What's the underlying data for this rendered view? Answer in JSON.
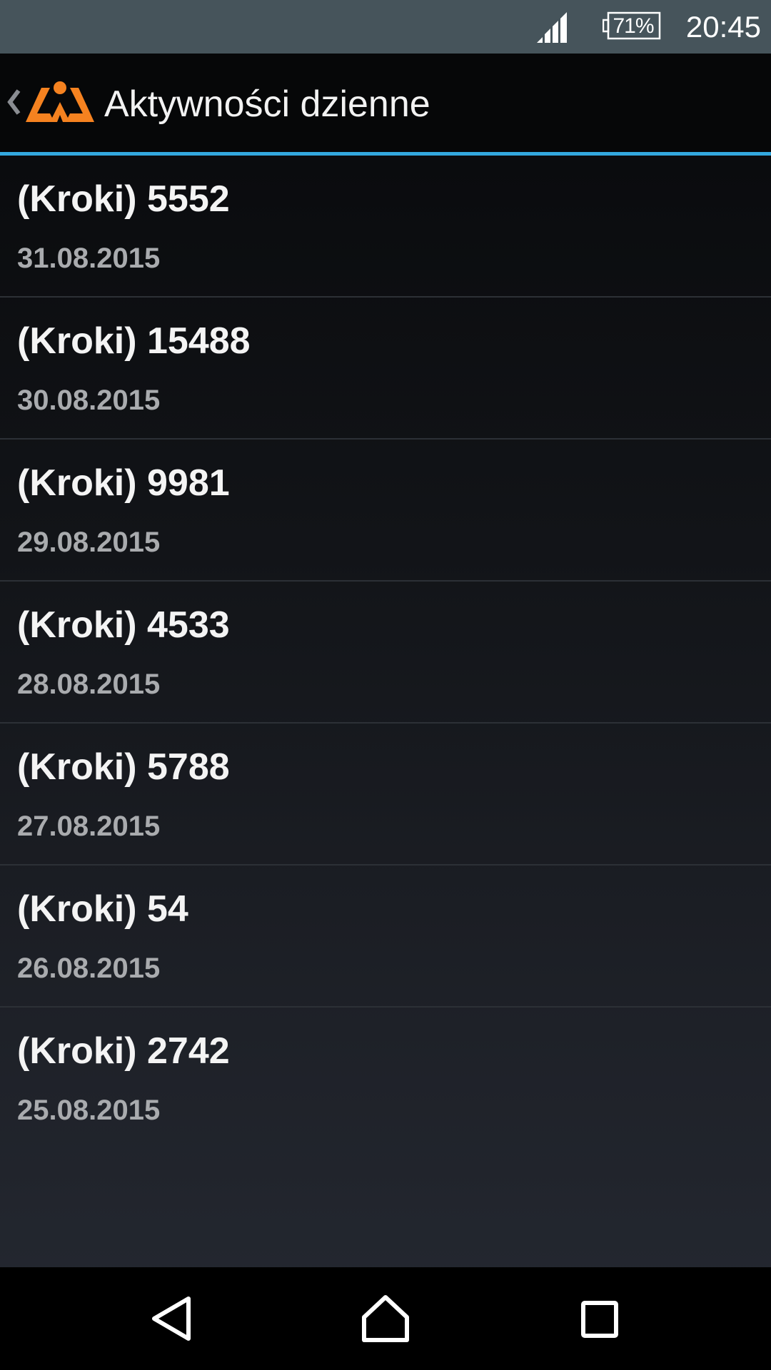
{
  "status_bar": {
    "battery_percent": "71%",
    "time": "20:45",
    "icons": [
      "signal-icon",
      "battery-icon"
    ],
    "color": "#46545b"
  },
  "action_bar": {
    "title": "Aktywności dzienne",
    "logo_color": "#f58220",
    "accent_color": "#33a8de"
  },
  "activities": [
    {
      "steps": "(Kroki) 5552",
      "date": "31.08.2015"
    },
    {
      "steps": "(Kroki) 15488",
      "date": "30.08.2015"
    },
    {
      "steps": "(Kroki) 9981",
      "date": "29.08.2015"
    },
    {
      "steps": "(Kroki) 4533",
      "date": "28.08.2015"
    },
    {
      "steps": "(Kroki) 5788",
      "date": "27.08.2015"
    },
    {
      "steps": "(Kroki) 54",
      "date": "26.08.2015"
    },
    {
      "steps": "(Kroki) 2742",
      "date": "25.08.2015"
    }
  ],
  "nav_bar": {
    "buttons": [
      "back-icon",
      "home-icon",
      "recents-icon"
    ]
  }
}
